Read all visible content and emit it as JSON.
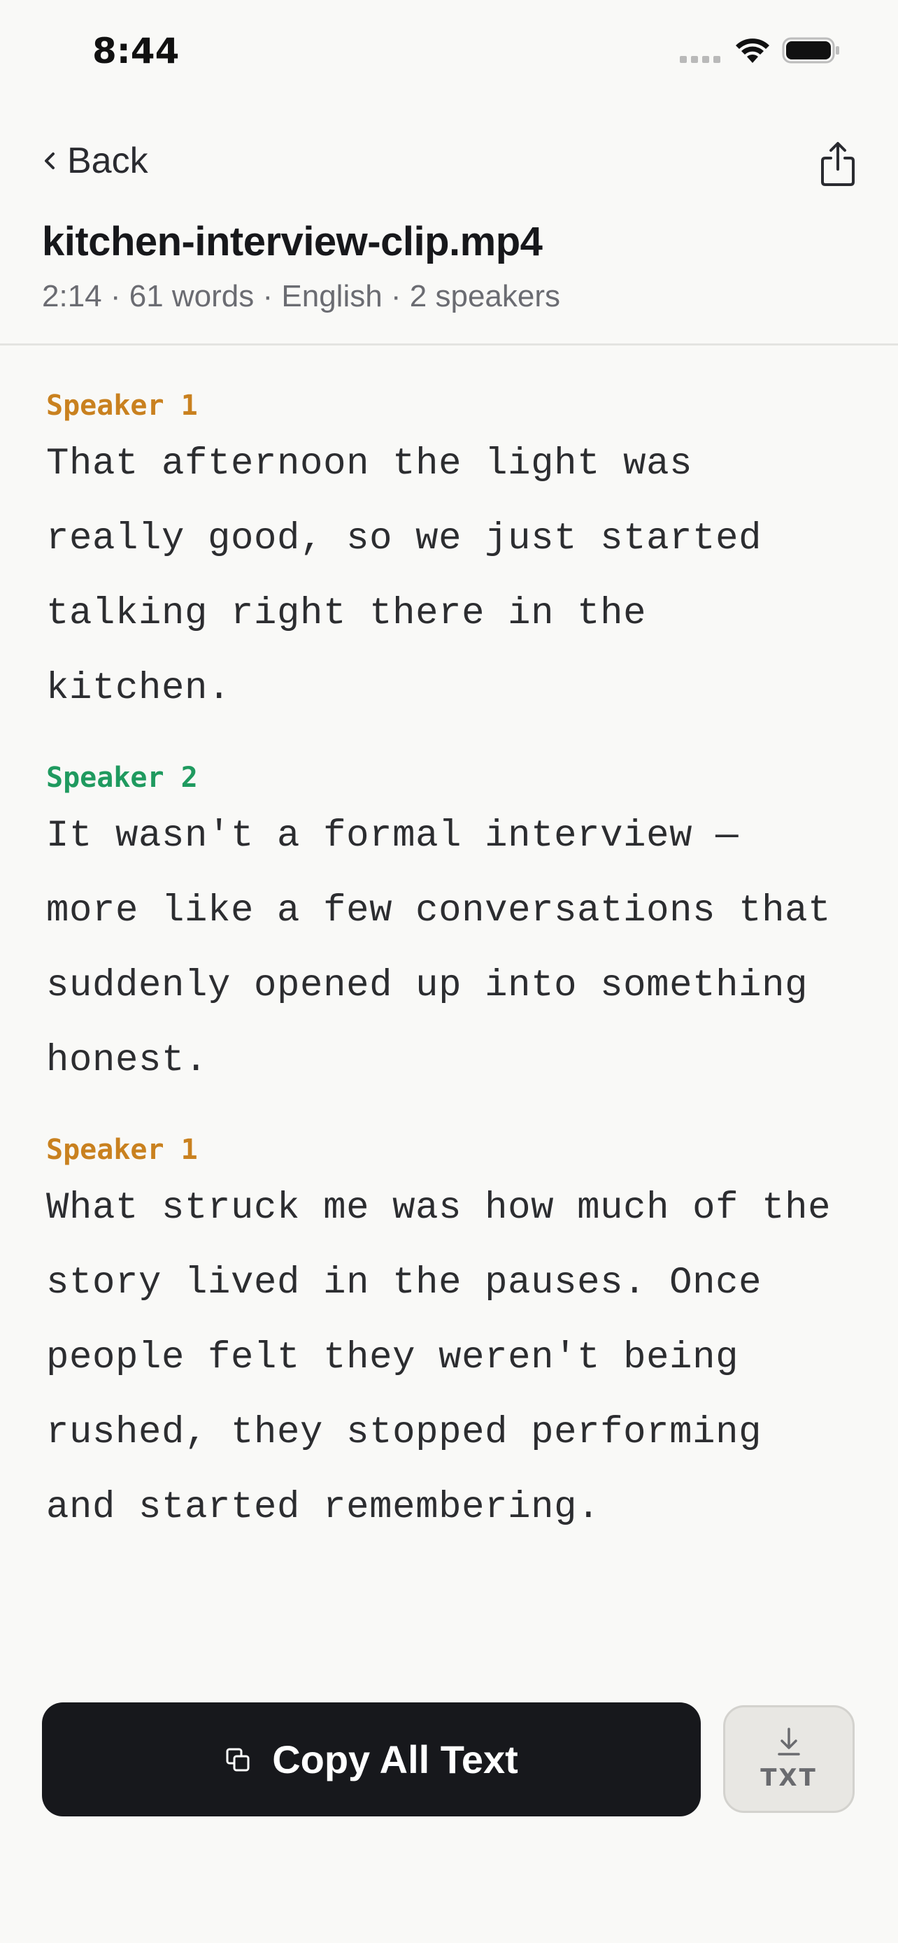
{
  "status_bar": {
    "time": "8:44"
  },
  "nav": {
    "back_label": "Back"
  },
  "file": {
    "title": "kitchen-interview-clip.mp4",
    "meta": "2:14 · 61 words · English · 2 speakers"
  },
  "speaker_colors": {
    "Speaker 1": "#c9811f",
    "Speaker 2": "#1f9a5f"
  },
  "transcript": [
    {
      "speaker": "Speaker 1",
      "text": "That afternoon the light was\nreally good, so we just started\ntalking right there in the\nkitchen."
    },
    {
      "speaker": "Speaker 2",
      "text": "It wasn't a formal interview —\nmore like a few conversations that\nsuddenly opened up into something\nhonest."
    },
    {
      "speaker": "Speaker 1",
      "text": "What struck me was how much of the\nstory lived in the pauses. Once\npeople felt they weren't being\nrushed, they stopped performing\nand started remembering."
    }
  ],
  "actions": {
    "copy_label": "Copy All Text",
    "download_label": "TXT"
  }
}
